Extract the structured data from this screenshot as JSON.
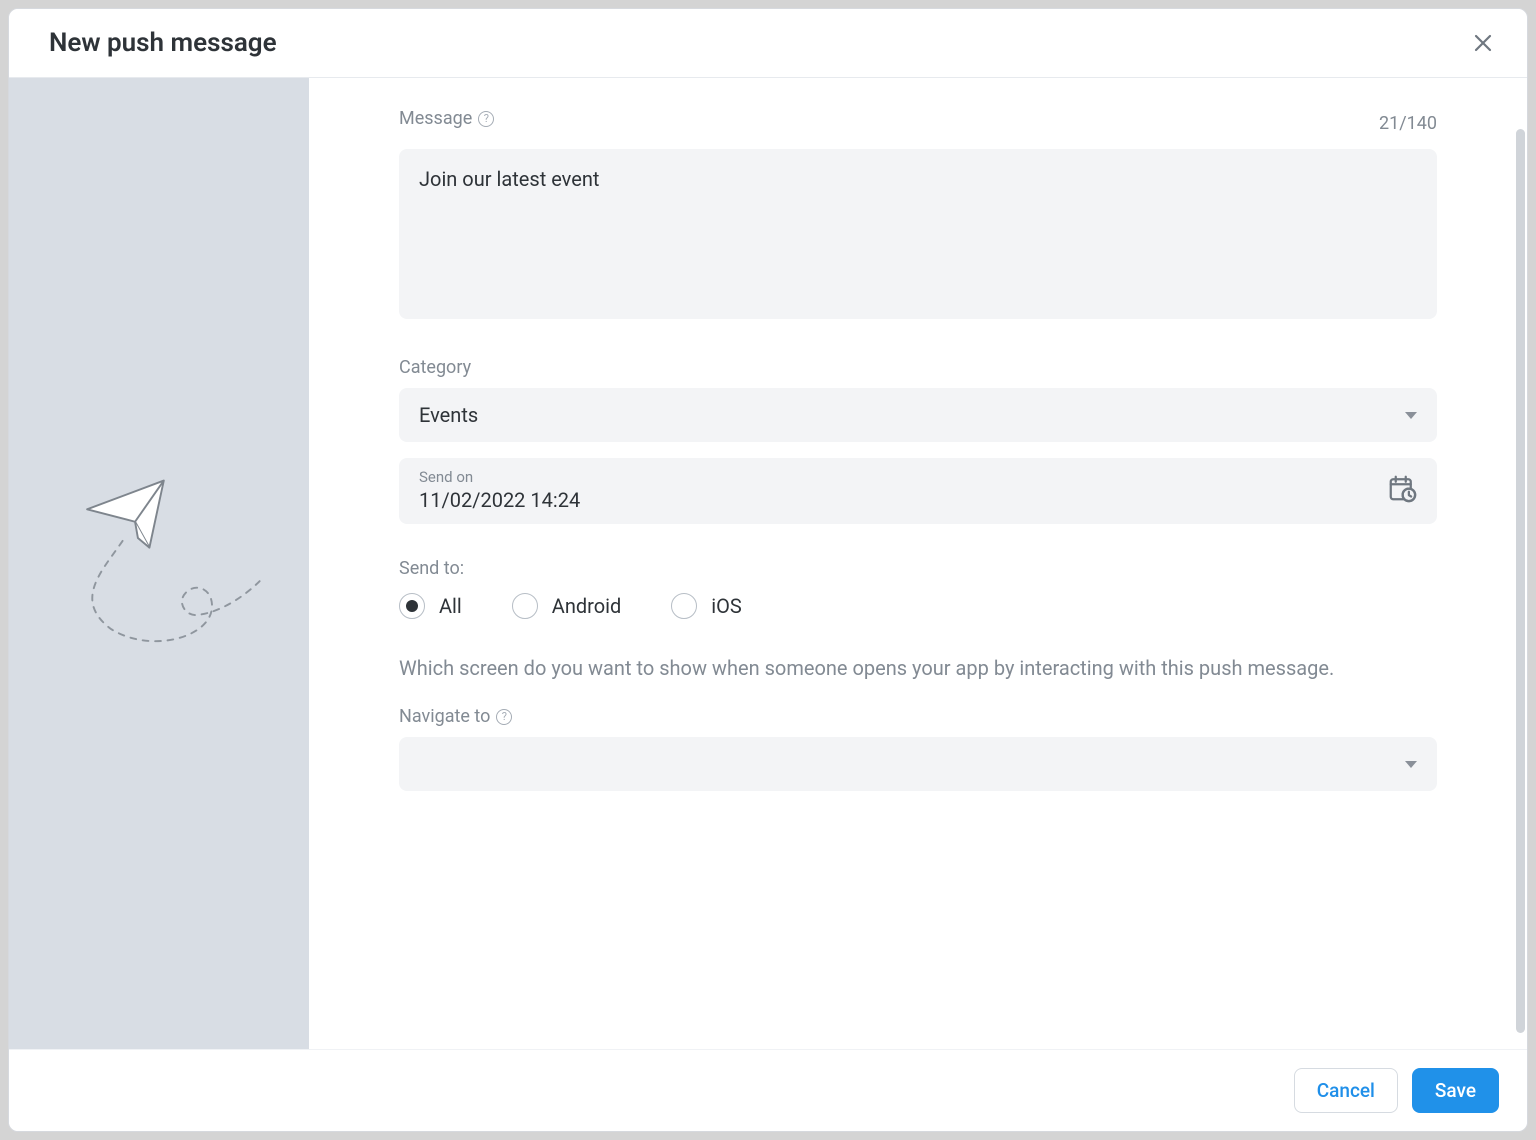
{
  "dialog": {
    "title": "New push message"
  },
  "message": {
    "label": "Message",
    "value": "Join our latest event",
    "char_count": "21/140"
  },
  "category": {
    "label": "Category",
    "value": "Events"
  },
  "send_on": {
    "label": "Send on",
    "value": "11/02/2022 14:24"
  },
  "send_to": {
    "label": "Send to:",
    "options": {
      "0": "All",
      "1": "Android",
      "2": "iOS"
    },
    "selected_index": 0
  },
  "navigate": {
    "description": "Which screen do you want to show when someone opens your app by interacting with this push message.",
    "label": "Navigate to",
    "value": ""
  },
  "footer": {
    "cancel": "Cancel",
    "save": "Save"
  }
}
